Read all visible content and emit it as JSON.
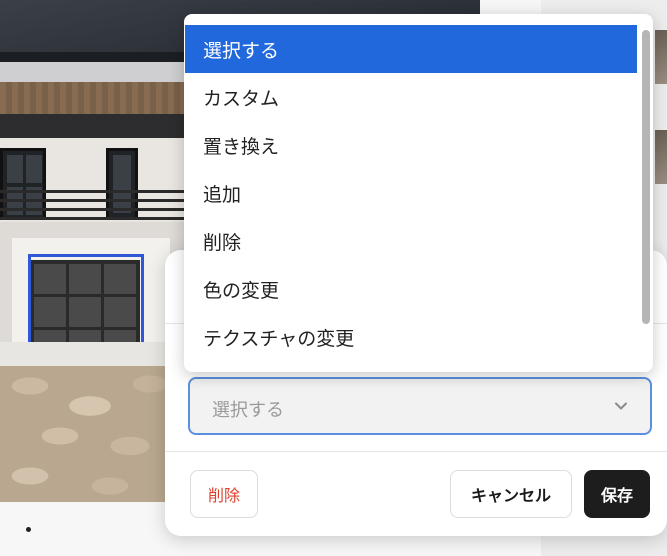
{
  "dropdown": {
    "options": [
      "選択する",
      "カスタム",
      "置き換え",
      "追加",
      "削除",
      "色の変更",
      "テクスチャの変更"
    ],
    "selected_index": 0
  },
  "select": {
    "value": "選択する"
  },
  "buttons": {
    "delete": "削除",
    "cancel": "キャンセル",
    "save": "保存"
  },
  "colors": {
    "accent": "#2268dd",
    "selection_outline": "#2f57d8",
    "delete_text": "#e0412e",
    "save_bg": "#1d1d1d"
  }
}
